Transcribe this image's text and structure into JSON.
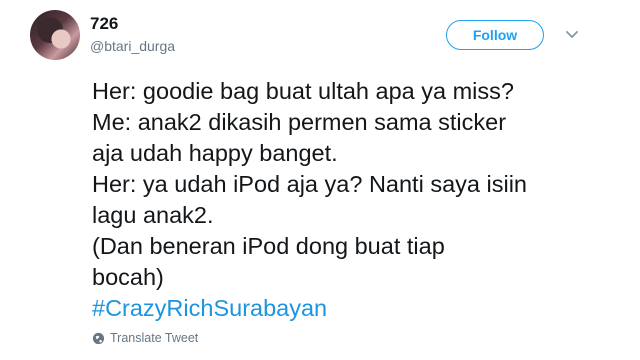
{
  "user": {
    "display_name": "726",
    "handle": "@btari_durga"
  },
  "follow_label": "Follow",
  "tweet": {
    "lines": [
      "Her: goodie bag buat ultah apa ya miss?",
      "Me: anak2 dikasih permen sama sticker",
      "aja udah happy banget.",
      "Her: ya udah iPod aja ya? Nanti saya isiin",
      "lagu anak2.",
      "(Dan beneran iPod dong buat tiap",
      "bocah)"
    ],
    "hashtag": "#CrazyRichSurabayan"
  },
  "translate_label": "Translate Tweet",
  "icons": {
    "more": "chevron-down-icon",
    "translate": "globe-icon"
  },
  "colors": {
    "accent": "#1da1f2",
    "hashtag": "#1b95e0",
    "secondary_text": "#657786"
  }
}
